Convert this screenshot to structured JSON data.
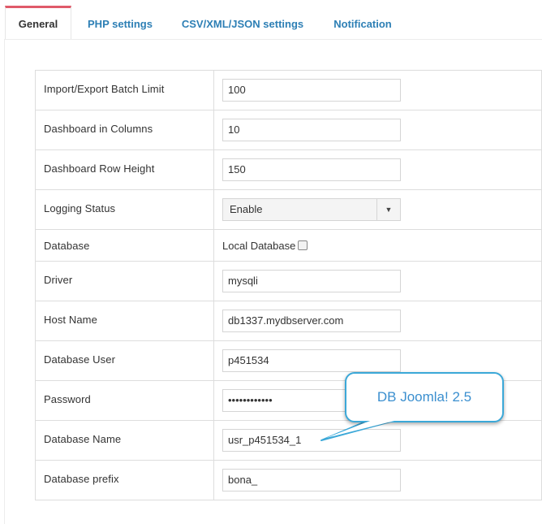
{
  "tabs": [
    {
      "label": "General",
      "active": true
    },
    {
      "label": "PHP settings",
      "active": false
    },
    {
      "label": "CSV/XML/JSON settings",
      "active": false
    },
    {
      "label": "Notification",
      "active": false
    }
  ],
  "rows": [
    {
      "label": "Import/Export Batch Limit",
      "value": "100"
    },
    {
      "label": "Dashboard in Columns",
      "value": "10"
    },
    {
      "label": "Dashboard Row Height",
      "value": "150"
    },
    {
      "label": "Logging Status",
      "value": "Enable"
    },
    {
      "label": "Database",
      "value": "Local Database"
    },
    {
      "label": "Driver",
      "value": "mysqli"
    },
    {
      "label": "Host Name",
      "value": "db1337.mydbserver.com"
    },
    {
      "label": "Database User",
      "value": "p451534"
    },
    {
      "label": "Password",
      "value": "••••••••••••"
    },
    {
      "label": "Database Name",
      "value": "usr_p451534_1"
    },
    {
      "label": "Database prefix",
      "value": "bona_"
    }
  ],
  "callout": {
    "text": "DB Joomla! 2.5",
    "border_color": "#3ba8d8",
    "text_color": "#3b8fcf"
  },
  "colors": {
    "tab_link": "#2d7fb5",
    "tab_active_border": "#e05a6a"
  },
  "icons": {
    "dropdown": "caret-down-icon",
    "checkbox": "checkbox-unchecked"
  }
}
